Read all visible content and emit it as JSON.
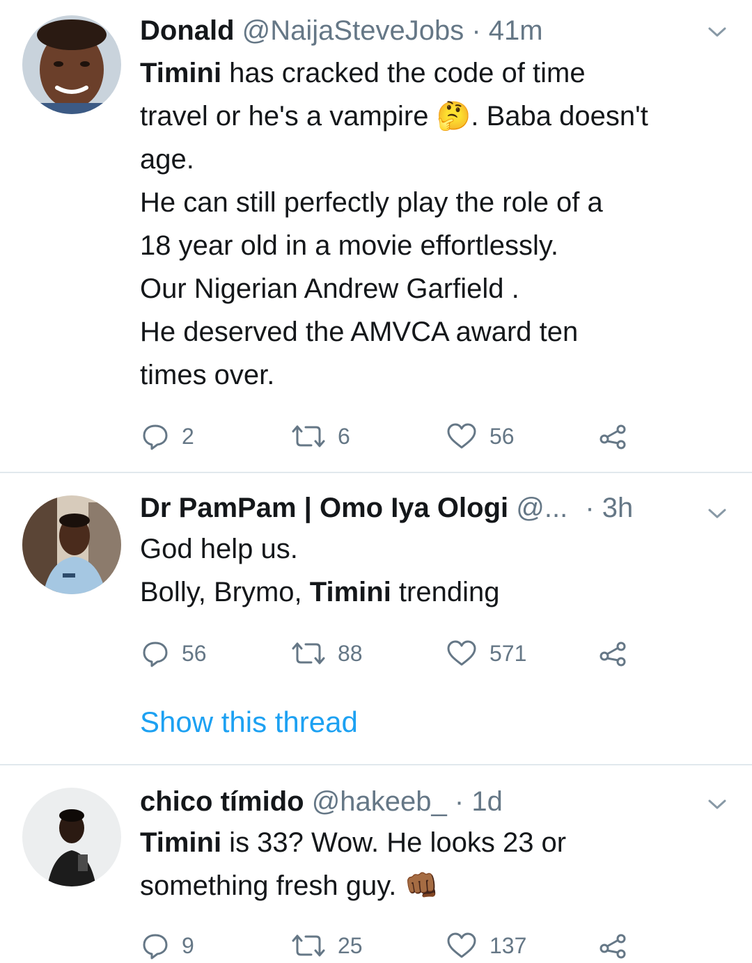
{
  "tweets": [
    {
      "name": "Donald",
      "handle": "@NaijaSteveJobs",
      "sep": "·",
      "time": "41m",
      "lines": [
        {
          "bold": "Timini",
          "text": " has cracked the code of time"
        },
        {
          "bold": "",
          "text": "travel or he's a vampire 🤔. Baba doesn't"
        },
        {
          "bold": "",
          "text": "age."
        },
        {
          "bold": "",
          "text": "He can still perfectly play the role of a"
        },
        {
          "bold": "",
          "text": "18 year old in a movie effortlessly."
        },
        {
          "bold": "",
          "text": "Our Nigerian  Andrew Garfield ."
        },
        {
          "bold": "",
          "text": "He deserved the AMVCA award ten"
        },
        {
          "bold": "",
          "text": "times over."
        }
      ],
      "reply_count": "2",
      "retweet_count": "6",
      "like_count": "56"
    },
    {
      "name": "Dr PamPam | Omo Iya Ologi",
      "handle": "@...",
      "sep": "·",
      "time": "3h",
      "lines": [
        {
          "bold": "",
          "text": "God help us."
        },
        {
          "bold_mid_prefix": "Bolly, Brymo, ",
          "bold": "Timini",
          "text": " trending"
        }
      ],
      "reply_count": "56",
      "retweet_count": "88",
      "like_count": "571",
      "thread_link": "Show this thread"
    },
    {
      "name": "chico tímido",
      "handle": "@hakeeb_",
      "sep": "·",
      "time": "1d",
      "lines": [
        {
          "bold": "Timini",
          "text": " is 33? Wow. He looks 23 or"
        },
        {
          "bold": "",
          "text": "something fresh guy. 👊🏾"
        }
      ],
      "reply_count": "9",
      "retweet_count": "25",
      "like_count": "137"
    }
  ],
  "colors": {
    "text": "#14171a",
    "muted": "#657786",
    "link": "#1da1f2",
    "divider": "#e1e8ed"
  },
  "icons": {
    "reply": "reply-icon",
    "retweet": "retweet-icon",
    "like": "like-icon",
    "share": "share-icon",
    "more": "chevron-down-icon"
  }
}
